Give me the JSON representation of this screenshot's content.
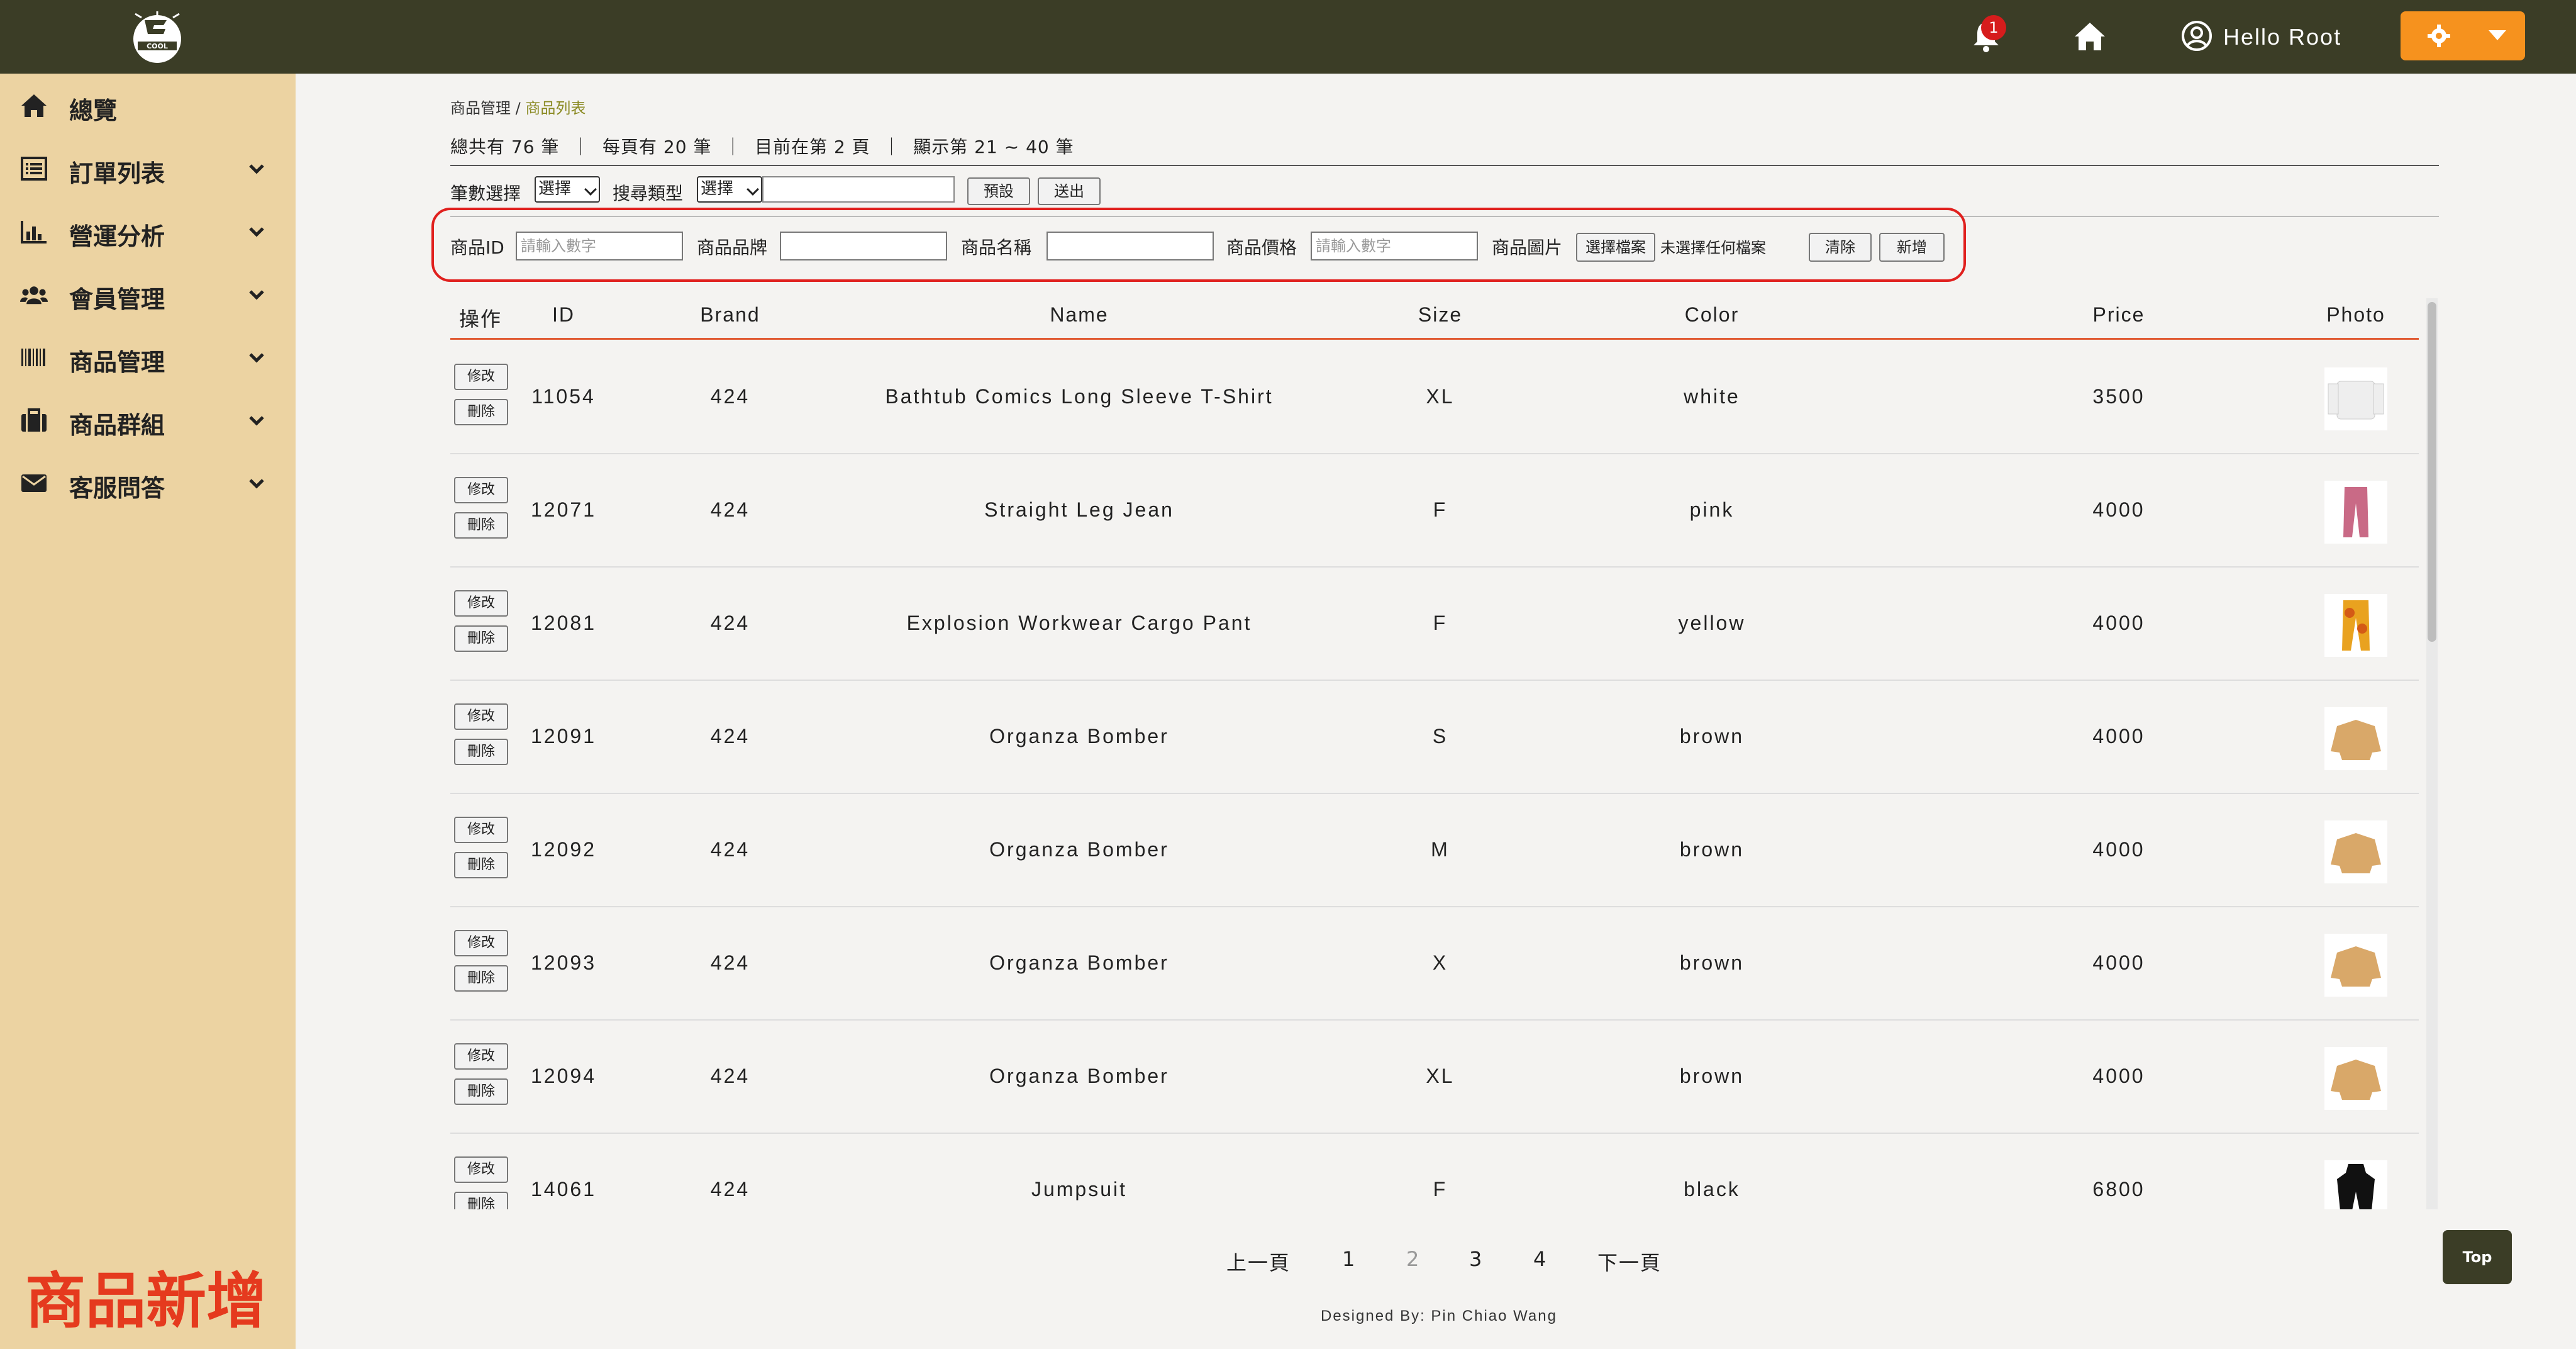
{
  "header": {
    "notification_count": "1",
    "user_greeting": "Hello Root",
    "logo_text": "COOL"
  },
  "sidebar": {
    "items": [
      {
        "label": "總覽",
        "icon": "home-icon",
        "expandable": false
      },
      {
        "label": "訂單列表",
        "icon": "list-icon",
        "expandable": true
      },
      {
        "label": "營運分析",
        "icon": "bar-chart-icon",
        "expandable": true
      },
      {
        "label": "會員管理",
        "icon": "users-icon",
        "expandable": true
      },
      {
        "label": "商品管理",
        "icon": "barcode-icon",
        "expandable": true
      },
      {
        "label": "商品群組",
        "icon": "briefcase-icon",
        "expandable": true
      },
      {
        "label": "客服問答",
        "icon": "envelope-icon",
        "expandable": true
      }
    ],
    "annotation": "商品新增"
  },
  "breadcrumb": {
    "parent": "商品管理",
    "separator": "/",
    "current": "商品列表"
  },
  "summary": "總共有 76 筆  ｜  每頁有 20 筆  ｜  目前在第 2 頁  ｜  顯示第 21 ~ 40 筆",
  "filter": {
    "count_label": "筆數選擇",
    "count_select": "選擇",
    "search_type_label": "搜尋類型",
    "search_type_select": "選擇",
    "search_value": "",
    "default_button": "預設",
    "submit_button": "送出"
  },
  "add_form": {
    "id_label": "商品ID",
    "id_placeholder": "請輸入數字",
    "brand_label": "商品品牌",
    "name_label": "商品名稱",
    "price_label": "商品價格",
    "price_placeholder": "請輸入數字",
    "image_label": "商品圖片",
    "choose_file_button": "選擇檔案",
    "no_file_text": "未選擇任何檔案",
    "clear_button": "清除",
    "add_button": "新增"
  },
  "table": {
    "columns": [
      "操作",
      "ID",
      "Brand",
      "Name",
      "Size",
      "Color",
      "Price",
      "Photo"
    ],
    "edit_label": "修改",
    "delete_label": "刪除",
    "rows": [
      {
        "id": "11054",
        "brand": "424",
        "name": "Bathtub Comics Long Sleeve T-Shirt",
        "size": "XL",
        "color": "white",
        "price": "3500",
        "photo": "white-longsleeve"
      },
      {
        "id": "12071",
        "brand": "424",
        "name": "Straight Leg Jean",
        "size": "F",
        "color": "pink",
        "price": "4000",
        "photo": "pink-jean"
      },
      {
        "id": "12081",
        "brand": "424",
        "name": "Explosion Workwear Cargo Pant",
        "size": "F",
        "color": "yellow",
        "price": "4000",
        "photo": "yellow-pant"
      },
      {
        "id": "12091",
        "brand": "424",
        "name": "Organza Bomber",
        "size": "S",
        "color": "brown",
        "price": "4000",
        "photo": "brown-bomber"
      },
      {
        "id": "12092",
        "brand": "424",
        "name": "Organza Bomber",
        "size": "M",
        "color": "brown",
        "price": "4000",
        "photo": "brown-bomber"
      },
      {
        "id": "12093",
        "brand": "424",
        "name": "Organza Bomber",
        "size": "X",
        "color": "brown",
        "price": "4000",
        "photo": "brown-bomber"
      },
      {
        "id": "12094",
        "brand": "424",
        "name": "Organza Bomber",
        "size": "XL",
        "color": "brown",
        "price": "4000",
        "photo": "brown-bomber"
      },
      {
        "id": "14061",
        "brand": "424",
        "name": "Jumpsuit",
        "size": "F",
        "color": "black",
        "price": "6800",
        "photo": "black-jumpsuit"
      }
    ]
  },
  "pagination": {
    "prev": "上一頁",
    "pages": [
      "1",
      "2",
      "3",
      "4"
    ],
    "current": "2",
    "next": "下一頁"
  },
  "footer": "Designed By: Pin Chiao Wang",
  "top_button": "Top",
  "colors": {
    "topbar": "#3b3d26",
    "sidebar": "#ecd3a2",
    "accent": "#f6921e",
    "highlight_box": "#e0201e",
    "table_header_line": "#e05a32"
  }
}
